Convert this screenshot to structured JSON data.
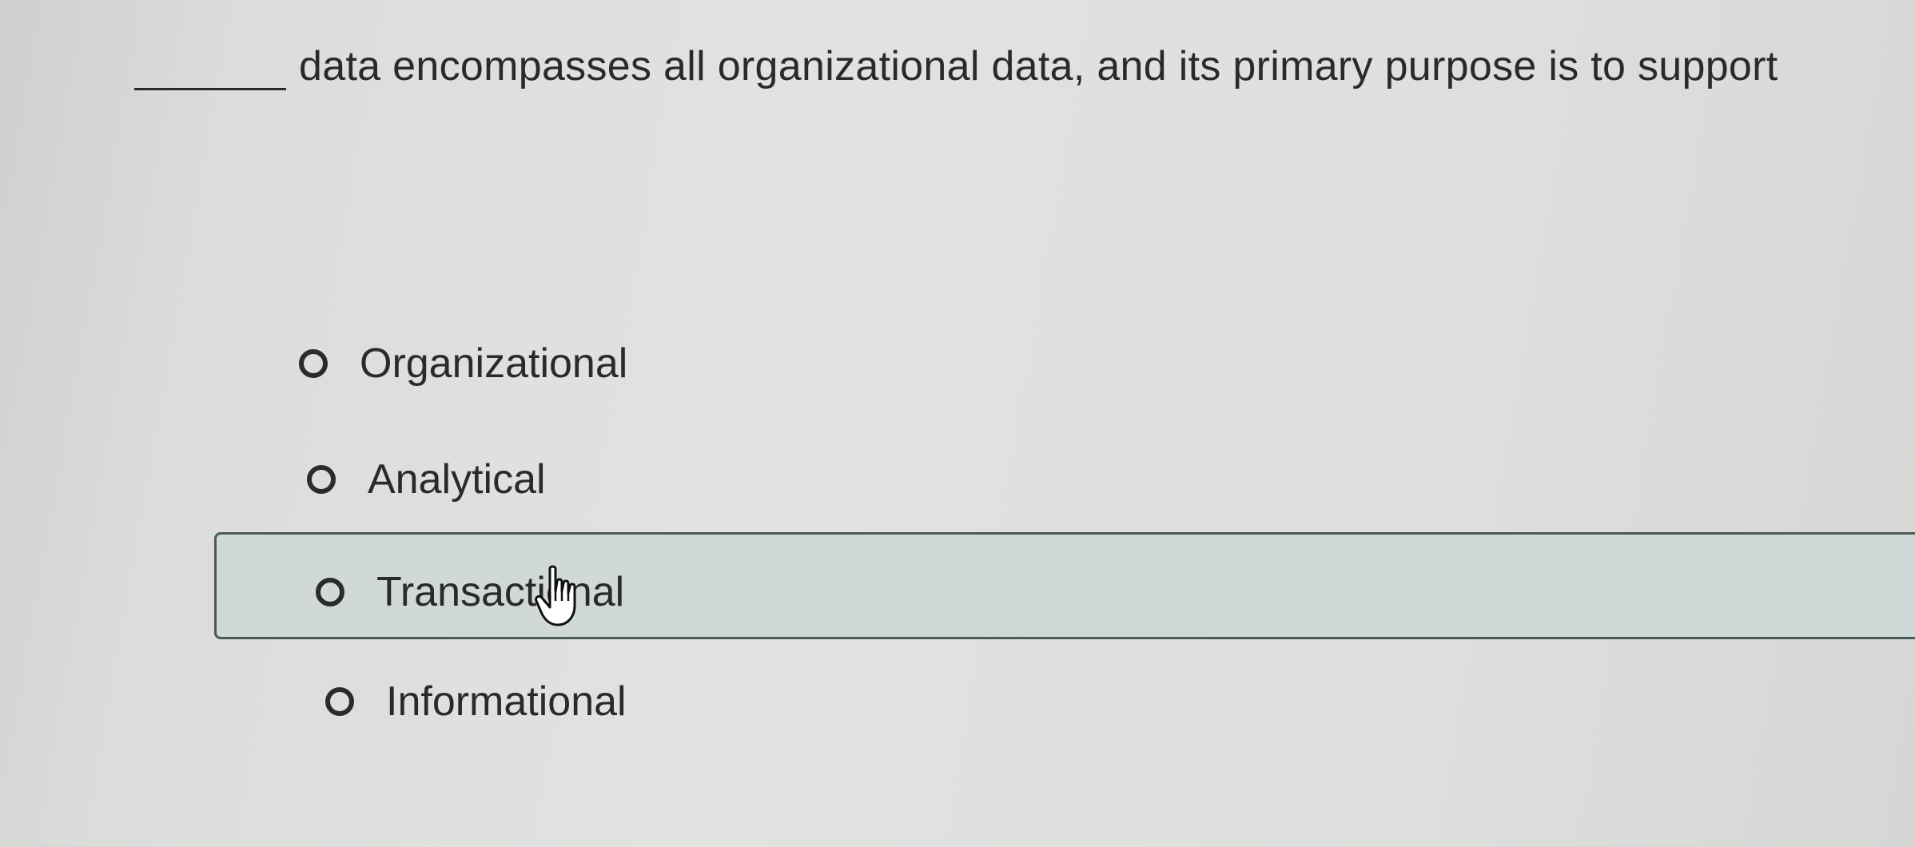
{
  "question": {
    "text": "data encompasses all organizational data, and its primary purpose is to support"
  },
  "options": [
    {
      "label": "Organizational",
      "selected": false
    },
    {
      "label": "Analytical",
      "selected": false
    },
    {
      "label": "Transactional",
      "selected": false,
      "hovered": true
    },
    {
      "label": "Informational",
      "selected": false
    }
  ],
  "icons": {
    "cursor": "hand-pointer-icon",
    "radio": "radio-unselected-icon"
  }
}
